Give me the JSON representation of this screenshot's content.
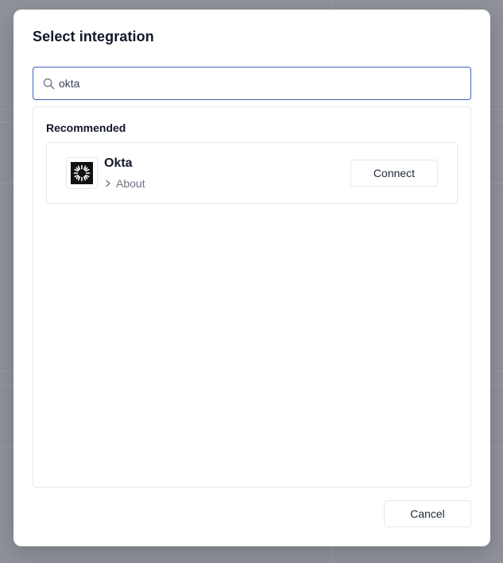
{
  "modal": {
    "title": "Select integration"
  },
  "search": {
    "value": "okta",
    "icon": "search-icon"
  },
  "results": {
    "section_heading": "Recommended",
    "items": [
      {
        "name": "Okta",
        "about_label": "About",
        "connect_label": "Connect",
        "logo": "okta-logo-icon",
        "chevron": "chevron-right-icon"
      }
    ]
  },
  "footer": {
    "cancel_label": "Cancel"
  },
  "colors": {
    "overlay": "#8f9299",
    "search_border": "#3b63b8",
    "card_border": "#e5e7eb",
    "logo_bg": "#111111"
  }
}
